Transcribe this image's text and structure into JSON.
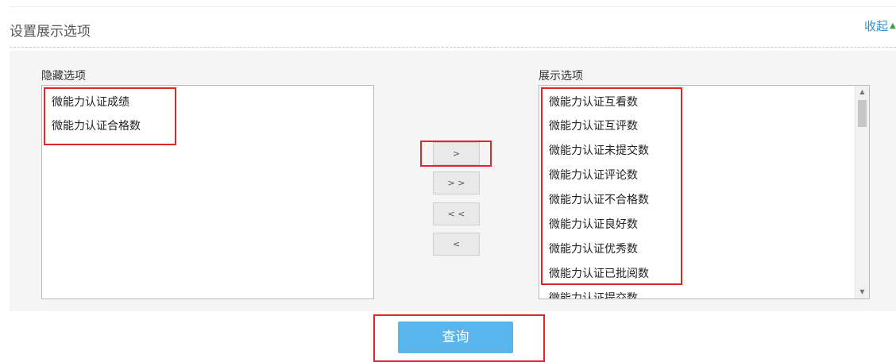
{
  "panel": {
    "title": "设置展示选项",
    "collapse_label": "收起"
  },
  "hidden_list": {
    "label": "隐藏选项",
    "items": [
      "微能力认证成绩",
      "微能力认证合格数"
    ]
  },
  "shown_list": {
    "label": "展示选项",
    "items": [
      "微能力认证互看数",
      "微能力认证互评数",
      "微能力认证未提交数",
      "微能力认证评论数",
      "微能力认证不合格数",
      "微能力认证良好数",
      "微能力认证优秀数",
      "微能力认证已批阅数",
      "微能力认证提交数"
    ]
  },
  "move_buttons": {
    "move_right": ">",
    "move_all_right": "> >",
    "move_all_left": "< <",
    "move_left": "<"
  },
  "query_button": "查询",
  "colors": {
    "accent_button": "#58b6ec",
    "link": "#2f8fd8",
    "annotation_red": "#e02727"
  }
}
